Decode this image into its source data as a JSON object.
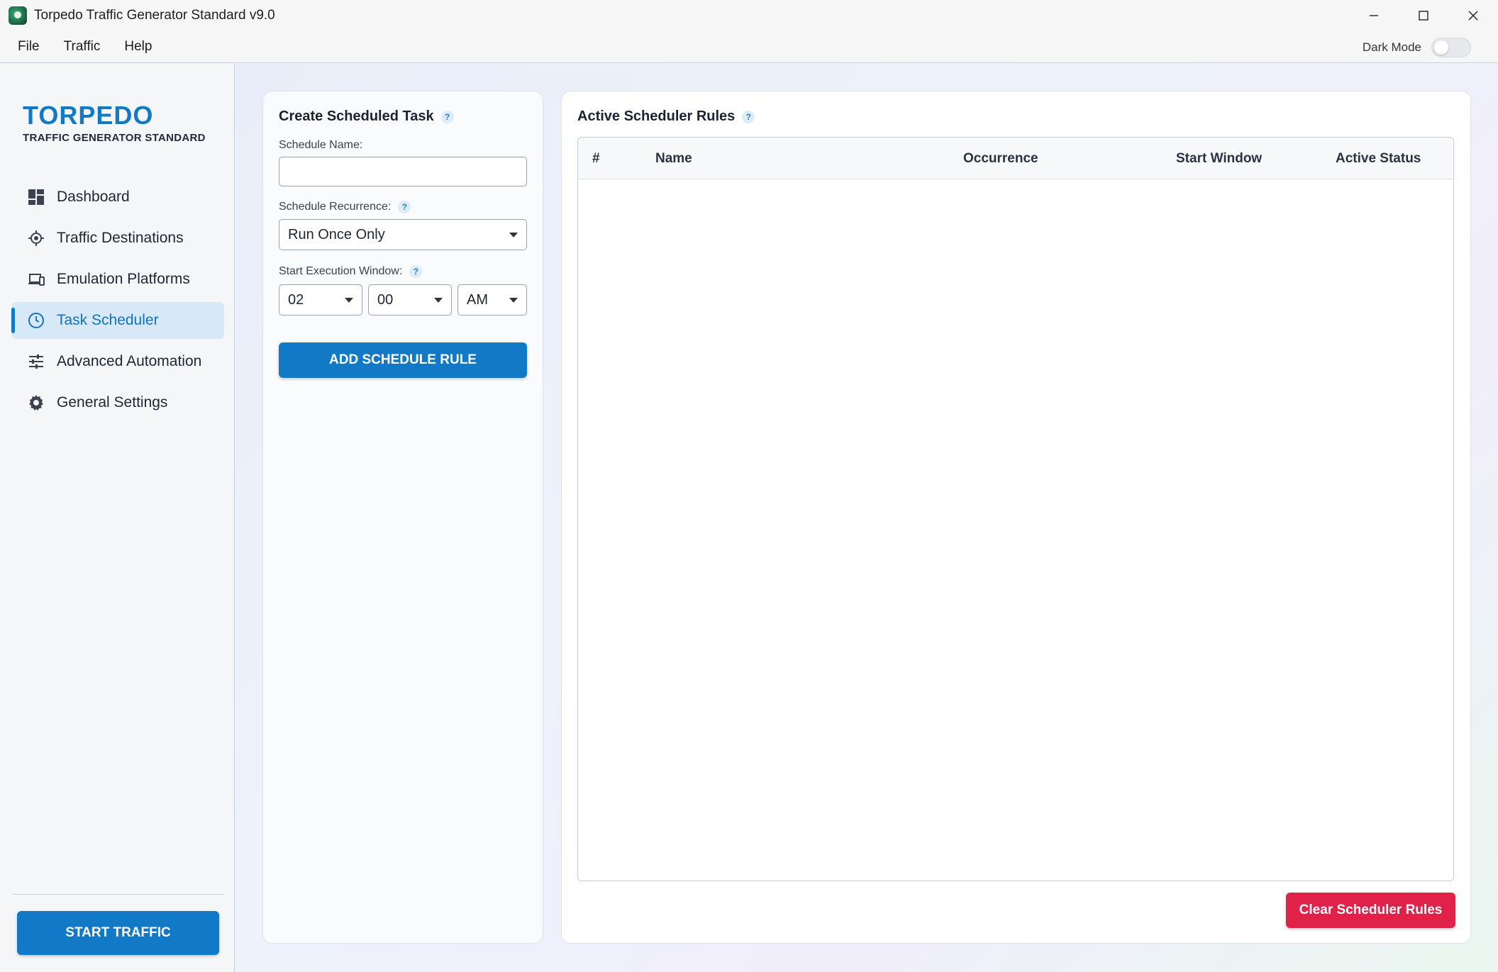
{
  "window": {
    "title": "Torpedo Traffic Generator Standard v9.0"
  },
  "menu": {
    "items": [
      "File",
      "Traffic",
      "Help"
    ],
    "dark_mode_label": "Dark Mode",
    "dark_mode_on": false
  },
  "sidebar": {
    "brand_name": "TORPEDO",
    "brand_sub": "TRAFFIC GENERATOR STANDARD",
    "items": [
      {
        "label": "Dashboard",
        "icon": "dashboard-icon"
      },
      {
        "label": "Traffic Destinations",
        "icon": "target-icon"
      },
      {
        "label": "Emulation Platforms",
        "icon": "devices-icon"
      },
      {
        "label": "Task Scheduler",
        "icon": "clock-icon",
        "active": true
      },
      {
        "label": "Advanced Automation",
        "icon": "sliders-icon"
      },
      {
        "label": "General Settings",
        "icon": "gear-icon"
      }
    ],
    "start_button": "START TRAFFIC"
  },
  "create_task": {
    "title": "Create Scheduled Task",
    "help": "?",
    "name_label": "Schedule Name:",
    "name_value": "",
    "recurrence_label": "Schedule Recurrence:",
    "recurrence_value": "Run Once Only",
    "window_label": "Start Execution Window:",
    "hour": "02",
    "minute": "00",
    "ampm": "AM",
    "add_button": "ADD SCHEDULE RULE"
  },
  "rules": {
    "title": "Active Scheduler Rules",
    "help": "?",
    "columns": [
      "#",
      "Name",
      "Occurrence",
      "Start Window",
      "Active Status"
    ],
    "rows": [],
    "clear_button": "Clear Scheduler Rules"
  },
  "colors": {
    "accent": "#1279c6",
    "danger": "#e0214a"
  }
}
